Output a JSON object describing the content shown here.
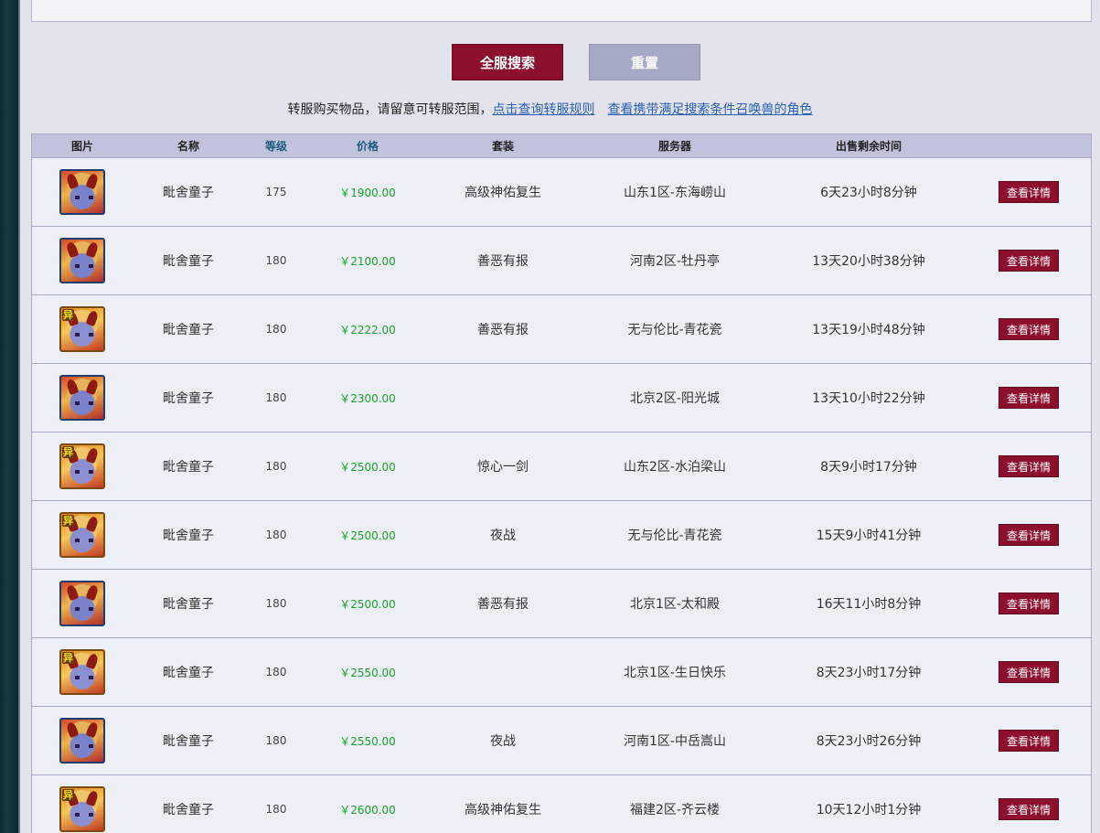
{
  "buttons": {
    "search_all": "全服搜索",
    "reset": "重置"
  },
  "notice": {
    "text": "转服购买物品，请留意可转服范围，",
    "rules_link": "点击查询转服规则",
    "pets_link": "查看携带满足搜索条件召唤兽的角色"
  },
  "table": {
    "headers": {
      "image": "图片",
      "name": "名称",
      "level": "等级",
      "price": "价格",
      "set": "套装",
      "server": "服务器",
      "time": "出售剩余时间"
    },
    "detail_label": "查看详情",
    "rows": [
      {
        "variant": "normal",
        "badge": "",
        "name": "毗舍童子",
        "level": "175",
        "price": "￥1900.00",
        "set": "高级神佑复生",
        "server": "山东1区-东海崂山",
        "time": "6天23小时8分钟"
      },
      {
        "variant": "normal",
        "badge": "",
        "name": "毗舍童子",
        "level": "180",
        "price": "￥2100.00",
        "set": "善恶有报",
        "server": "河南2区-牡丹亭",
        "time": "13天20小时38分钟"
      },
      {
        "variant": "variant",
        "badge": "异",
        "name": "毗舍童子",
        "level": "180",
        "price": "￥2222.00",
        "set": "善恶有报",
        "server": "无与伦比-青花瓷",
        "time": "13天19小时48分钟"
      },
      {
        "variant": "normal",
        "badge": "",
        "name": "毗舍童子",
        "level": "180",
        "price": "￥2300.00",
        "set": "",
        "server": "北京2区-阳光城",
        "time": "13天10小时22分钟"
      },
      {
        "variant": "variant",
        "badge": "异",
        "name": "毗舍童子",
        "level": "180",
        "price": "￥2500.00",
        "set": "惊心一剑",
        "server": "山东2区-水泊梁山",
        "time": "8天9小时17分钟"
      },
      {
        "variant": "variant",
        "badge": "异",
        "name": "毗舍童子",
        "level": "180",
        "price": "￥2500.00",
        "set": "夜战",
        "server": "无与伦比-青花瓷",
        "time": "15天9小时41分钟"
      },
      {
        "variant": "normal",
        "badge": "",
        "name": "毗舍童子",
        "level": "180",
        "price": "￥2500.00",
        "set": "善恶有报",
        "server": "北京1区-太和殿",
        "time": "16天11小时8分钟"
      },
      {
        "variant": "variant",
        "badge": "异",
        "name": "毗舍童子",
        "level": "180",
        "price": "￥2550.00",
        "set": "",
        "server": "北京1区-生日快乐",
        "time": "8天23小时17分钟"
      },
      {
        "variant": "normal",
        "badge": "",
        "name": "毗舍童子",
        "level": "180",
        "price": "￥2550.00",
        "set": "夜战",
        "server": "河南1区-中岳嵩山",
        "time": "8天23小时26分钟"
      },
      {
        "variant": "variant",
        "badge": "异",
        "name": "毗舍童子",
        "level": "180",
        "price": "￥2600.00",
        "set": "高级神佑复生",
        "server": "福建2区-齐云楼",
        "time": "10天12小时1分钟"
      }
    ]
  }
}
